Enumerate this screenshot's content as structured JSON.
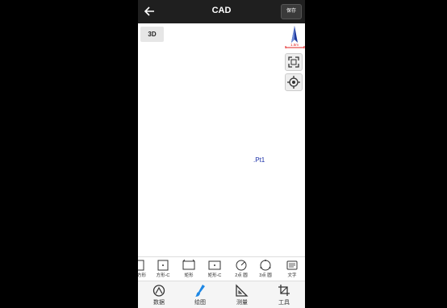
{
  "header": {
    "title": "CAD",
    "save_label": "保存"
  },
  "canvas": {
    "view_toggle_label": "3D",
    "scale_text": "1.5m",
    "point_label": ".Pt1"
  },
  "toolstrip": {
    "items": [
      {
        "label": "方形",
        "icon": "square-icon"
      },
      {
        "label": "方形-C",
        "icon": "square-center-icon"
      },
      {
        "label": "矩形",
        "icon": "rectangle-icon"
      },
      {
        "label": "矩形-C",
        "icon": "rectangle-center-icon"
      },
      {
        "label": "2点 圆",
        "icon": "circle-2pt-icon"
      },
      {
        "label": "3点 圆",
        "icon": "circle-3pt-icon"
      },
      {
        "label": "文字",
        "icon": "text-icon"
      }
    ]
  },
  "bottom_nav": {
    "items": [
      {
        "label": "数据",
        "icon": "data-icon"
      },
      {
        "label": "绘图",
        "icon": "brush-icon",
        "active": true
      },
      {
        "label": "测量",
        "icon": "measure-icon"
      },
      {
        "label": "工具",
        "icon": "tools-icon"
      }
    ]
  },
  "colors": {
    "active": "#1e88e5",
    "topbar": "#1f1f1f",
    "point": "#1a2fa8"
  }
}
